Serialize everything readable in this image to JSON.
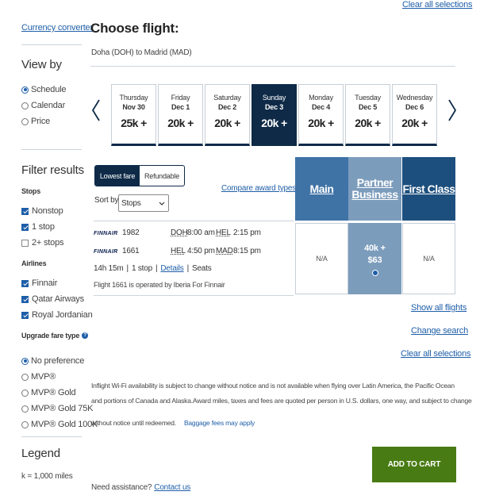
{
  "top_link": "Clear all selections",
  "sidebar": {
    "currency_link": "Currency converter",
    "view_by_title": "View by",
    "view_by_options": [
      "Schedule",
      "Calendar",
      "Price"
    ],
    "filter_title": "Filter results",
    "stops_title": "Stops",
    "stops": [
      "Nonstop",
      "1 stop",
      "2+ stops"
    ],
    "airlines_title": "Airlines",
    "airlines": [
      "Finnair",
      "Qatar Airways",
      "Royal Jordanian"
    ],
    "upgrade_title": "Upgrade fare type",
    "upgrade_options": [
      "No preference",
      "MVP®",
      "MVP® Gold",
      "MVP® Gold 75K",
      "MVP® Gold 100K"
    ],
    "legend_title": "Legend",
    "legend_text": "k = 1,000 miles"
  },
  "main": {
    "title": "Choose flight:",
    "route": "Doha (DOH) to Madrid (MAD)",
    "dates": [
      {
        "dow": "Thursday",
        "md": "Nov 30",
        "price": "25k +"
      },
      {
        "dow": "Friday",
        "md": "Dec 1",
        "price": "20k +"
      },
      {
        "dow": "Saturday",
        "md": "Dec 2",
        "price": "20k +"
      },
      {
        "dow": "Sunday",
        "md": "Dec 3",
        "price": "20k +"
      },
      {
        "dow": "Monday",
        "md": "Dec 4",
        "price": "20k +"
      },
      {
        "dow": "Tuesday",
        "md": "Dec 5",
        "price": "20k +"
      },
      {
        "dow": "Wednesday",
        "md": "Dec 6",
        "price": "20k +"
      }
    ],
    "fare_toggle": [
      "Lowest fare",
      "Refundable"
    ],
    "compare_link": "Compare award types",
    "sort_label": "Sort by",
    "sort_value": "Stops",
    "cabins": [
      {
        "name": "Main",
        "color": "#3f73a6"
      },
      {
        "name": "Partner Business",
        "color": "#7c9cbc"
      },
      {
        "name": "First Class",
        "color": "#1d4f7e"
      }
    ],
    "flight": {
      "airline_logo": "FINNAIR",
      "segments": [
        {
          "num": "1982",
          "from": "DOH",
          "dep": "8:00 am",
          "to": "HEL",
          "arr": "2:15 pm"
        },
        {
          "num": "1661",
          "from": "HEL",
          "dep": "4:50 pm",
          "to": "MAD",
          "arr": "8:15 pm"
        }
      ],
      "duration": "14h 15m",
      "stops": "1 stop",
      "details_link": "Details",
      "seats": "Seats",
      "operated_note": "Flight 1661 is operated by Iberia For Finnair",
      "fares": [
        "N/A",
        "40k +",
        "N/A"
      ],
      "partner_cash": "$63"
    },
    "show_all": "Show all flights",
    "change_search": "Change search",
    "clear_all": "Clear all selections",
    "disclaimer_1": "Inflight Wi-Fi availability is subject to change without notice and is not available when flying over Latin America, the Pacific Ocean",
    "disclaimer_2": "and portions of Canada and Alaska.Award miles, taxes and fees are quoted per person in U.S. dollars, one way, and subject to change",
    "disclaimer_3": "without notice until redeemed.",
    "baggage_link": "Baggage fees may apply",
    "add_to_cart": "ADD TO CART",
    "assist_text": "Need assistance?",
    "contact_link": "Contact us"
  }
}
